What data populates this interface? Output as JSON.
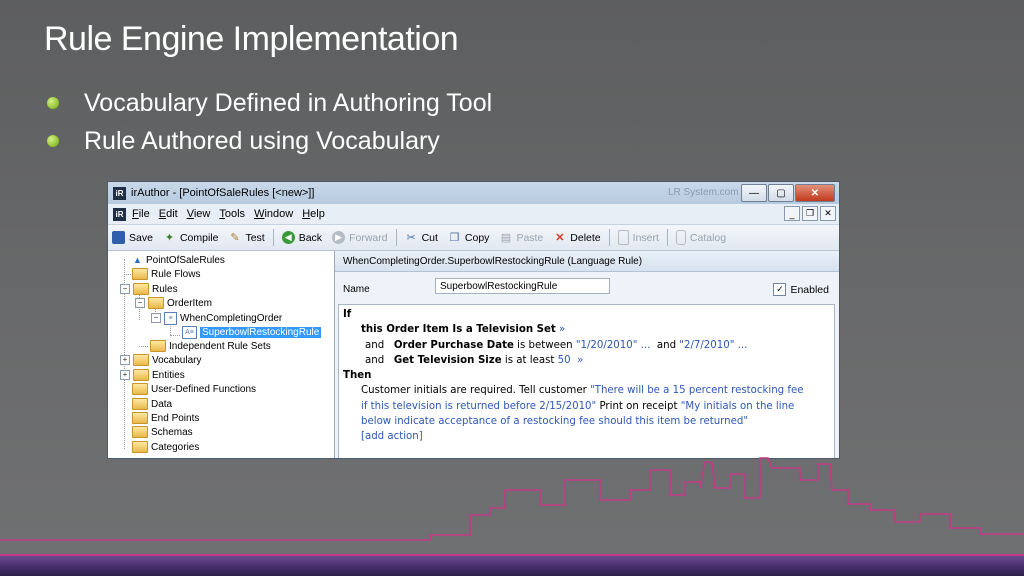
{
  "slide": {
    "title": "Rule Engine Implementation",
    "bullets": [
      "Vocabulary Defined in Authoring Tool",
      "Rule Authored using Vocabulary"
    ]
  },
  "window": {
    "app_icon": "iR",
    "title": "irAuthor - [PointOfSaleRules [<new>]]",
    "faded_text": "LR System.com",
    "controls": {
      "minimize": "—",
      "maximize": "▢",
      "close": "✕"
    },
    "menu": [
      "File",
      "Edit",
      "View",
      "Tools",
      "Window",
      "Help"
    ],
    "mdi_controls": {
      "minimize": "_",
      "restore": "❐",
      "close": "✕"
    },
    "toolbar": {
      "save": "Save",
      "compile": "Compile",
      "test": "Test",
      "back": "Back",
      "forward": "Forward",
      "cut": "Cut",
      "copy": "Copy",
      "paste": "Paste",
      "delete": "Delete",
      "insert": "Insert",
      "catalog": "Catalog"
    },
    "tree": {
      "root": "PointOfSaleRules",
      "rule_flows": "Rule Flows",
      "rules": "Rules",
      "order_item": "OrderItem",
      "when_completing": "WhenCompletingOrder",
      "selected_rule": "SuperbowlRestockingRule",
      "independent": "Independent Rule Sets",
      "vocabulary": "Vocabulary",
      "entities": "Entities",
      "udf": "User-Defined Functions",
      "data": "Data",
      "end_points": "End Points",
      "schemas": "Schemas",
      "categories": "Categories"
    },
    "editor": {
      "header": "WhenCompletingOrder.SuperbowlRestockingRule (Language Rule)",
      "name_label": "Name",
      "name_value": "SuperbowlRestockingRule",
      "enabled_label": "Enabled",
      "enabled_check": "✓",
      "rule": {
        "if": "If",
        "cond1": "this Order Item Is a Television Set",
        "cond1_arrow": "»",
        "and": "and",
        "cond2_field": "Order Purchase Date",
        "cond2_op": "is between",
        "cond2_v1": "\"1/20/2010\" ...",
        "cond2_and": "and",
        "cond2_v2": "\"2/7/2010\" ...",
        "cond3_field": "Get Television Size",
        "cond3_op": "is at least",
        "cond3_val": "50",
        "cond3_arrow": "»",
        "then": "Then",
        "action_a": "Customer initials are required.  Tell customer",
        "action_b1": "\"There will be a 15 percent restocking fee",
        "action_b2": "if this television is returned before 2/15/2010\"",
        "action_c": "Print on receipt",
        "action_d1": "\"My initials on the line",
        "action_d2": "below indicate acceptance of a restocking fee should this item be returned\"",
        "add_action": "[add action]"
      }
    }
  },
  "colors": {
    "accent_line": "#c23b86",
    "selection": "#3399ff",
    "link_blue": "#2f58b8"
  }
}
